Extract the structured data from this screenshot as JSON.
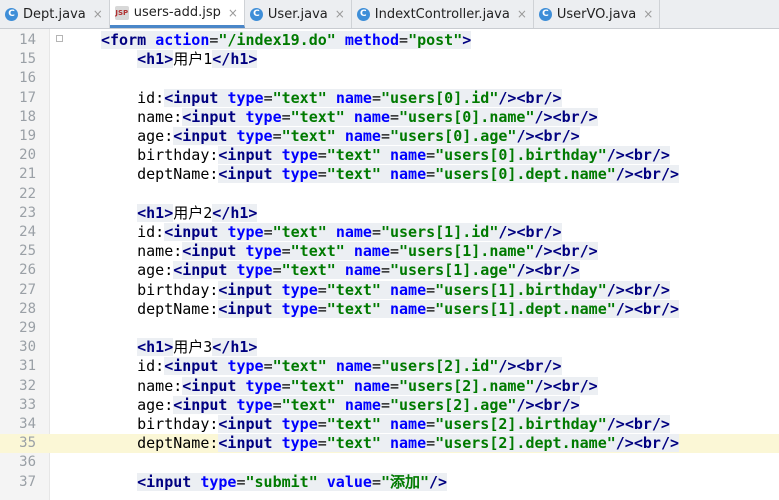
{
  "tabs": [
    {
      "label": "Dept.java",
      "icon": "c-class-icon",
      "active": false
    },
    {
      "label": "users-add.jsp",
      "icon": "jsp-file-icon",
      "active": true
    },
    {
      "label": "User.java",
      "icon": "c-class-icon",
      "active": false
    },
    {
      "label": "IndextController.java",
      "icon": "c-class-icon",
      "active": false
    },
    {
      "label": "UserVO.java",
      "icon": "c-class-icon",
      "active": false
    }
  ],
  "close_glyph": "×",
  "class_icon_glyph": "C",
  "jsp_icon_glyph": "JSP",
  "current_line": 35,
  "lines": [
    {
      "num": "14",
      "code": "<form action=\"/index19.do\" method=\"post\">"
    },
    {
      "num": "15",
      "code": "    <h1>用户1</h1>"
    },
    {
      "num": "16",
      "code": ""
    },
    {
      "num": "17",
      "code": "    id:<input type=\"text\" name=\"users[0].id\"/><br/>"
    },
    {
      "num": "18",
      "code": "    name:<input type=\"text\" name=\"users[0].name\"/><br/>"
    },
    {
      "num": "19",
      "code": "    age:<input type=\"text\" name=\"users[0].age\"/><br/>"
    },
    {
      "num": "20",
      "code": "    birthday:<input type=\"text\" name=\"users[0].birthday\"/><br/>"
    },
    {
      "num": "21",
      "code": "    deptName:<input type=\"text\" name=\"users[0].dept.name\"/><br/>"
    },
    {
      "num": "22",
      "code": ""
    },
    {
      "num": "23",
      "code": "    <h1>用户2</h1>"
    },
    {
      "num": "24",
      "code": "    id:<input type=\"text\" name=\"users[1].id\"/><br/>"
    },
    {
      "num": "25",
      "code": "    name:<input type=\"text\" name=\"users[1].name\"/><br/>"
    },
    {
      "num": "26",
      "code": "    age:<input type=\"text\" name=\"users[1].age\"/><br/>"
    },
    {
      "num": "27",
      "code": "    birthday:<input type=\"text\" name=\"users[1].birthday\"/><br/>"
    },
    {
      "num": "28",
      "code": "    deptName:<input type=\"text\" name=\"users[1].dept.name\"/><br/>"
    },
    {
      "num": "29",
      "code": ""
    },
    {
      "num": "30",
      "code": "    <h1>用户3</h1>"
    },
    {
      "num": "31",
      "code": "    id:<input type=\"text\" name=\"users[2].id\"/><br/>"
    },
    {
      "num": "32",
      "code": "    name:<input type=\"text\" name=\"users[2].name\"/><br/>"
    },
    {
      "num": "33",
      "code": "    age:<input type=\"text\" name=\"users[2].age\"/><br/>"
    },
    {
      "num": "34",
      "code": "    birthday:<input type=\"text\" name=\"users[2].birthday\"/><br/>"
    },
    {
      "num": "35",
      "code": "    deptName:<input type=\"text\" name=\"users[2].dept.name\"/><br/>"
    },
    {
      "num": "36",
      "code": ""
    },
    {
      "num": "37",
      "code": "    <input type=\"submit\" value=\"添加\"/>"
    }
  ],
  "colors": {
    "tag": "#000080",
    "attribute": "#0000ff",
    "string": "#007a00",
    "current_line_bg": "#fbf7d6",
    "active_tab_underline": "#4a86c8"
  }
}
